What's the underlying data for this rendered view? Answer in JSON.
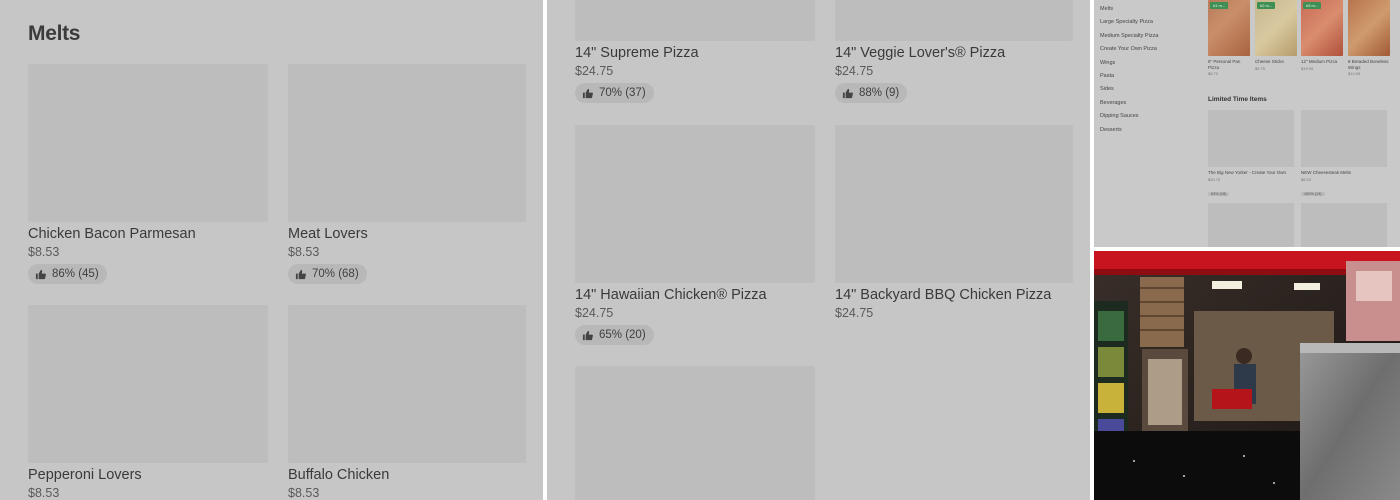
{
  "panel1": {
    "section_title": "Melts",
    "items": [
      {
        "name": "Chicken Bacon Parmesan",
        "price": "$8.53",
        "rating": "86% (45)"
      },
      {
        "name": "Meat Lovers",
        "price": "$8.53",
        "rating": "70% (68)"
      },
      {
        "name": "Pepperoni Lovers",
        "price": "$8.53",
        "rating": ""
      },
      {
        "name": "Buffalo Chicken",
        "price": "$8.53",
        "rating": ""
      }
    ]
  },
  "panel2": {
    "items": [
      {
        "name": "14\" Supreme Pizza",
        "price": "$24.75",
        "rating": "70% (37)"
      },
      {
        "name": "14\" Veggie Lover's® Pizza",
        "price": "$24.75",
        "rating": "88% (9)"
      },
      {
        "name": "14\" Hawaiian Chicken® Pizza",
        "price": "$24.75",
        "rating": "65% (20)"
      },
      {
        "name": "14\" Backyard BBQ Chicken Pizza",
        "price": "$24.75",
        "rating": ""
      }
    ]
  },
  "panel3": {
    "categories": [
      "Melts",
      "Large Specialty Pizza",
      "Medium Specialty Pizza",
      "Create Your Own Pizza",
      "Wings",
      "Pasta",
      "Sides",
      "Beverages",
      "Dipping Sauces",
      "Desserts"
    ],
    "top_items": [
      {
        "name": "6\" Personal Pan Pizza",
        "price": "$6.70",
        "badge": "#1 m..."
      },
      {
        "name": "Cheese Sticks",
        "price": "$9.75",
        "badge": "#2 m..."
      },
      {
        "name": "12\" Medium Pizza",
        "price": "$19.99",
        "badge": "#3 m..."
      },
      {
        "name": "8 Breaded Boneless Wings",
        "price": "$10.95",
        "badge": ""
      }
    ],
    "limited_title": "Limited Time Items",
    "limited_items": [
      {
        "name": "The Big New Yorker - Create Your Own",
        "price": "$20.75",
        "rating": "63% (18)"
      },
      {
        "name": "NEW Cheesesteak Melts",
        "price": "$8.53",
        "rating": "100% (13)"
      }
    ]
  },
  "colors": {
    "overlay_gray": "#c6c6c6",
    "placeholder": "#bdbdbd",
    "badge_green": "#3f8f55",
    "awning_red": "#c8141e"
  }
}
